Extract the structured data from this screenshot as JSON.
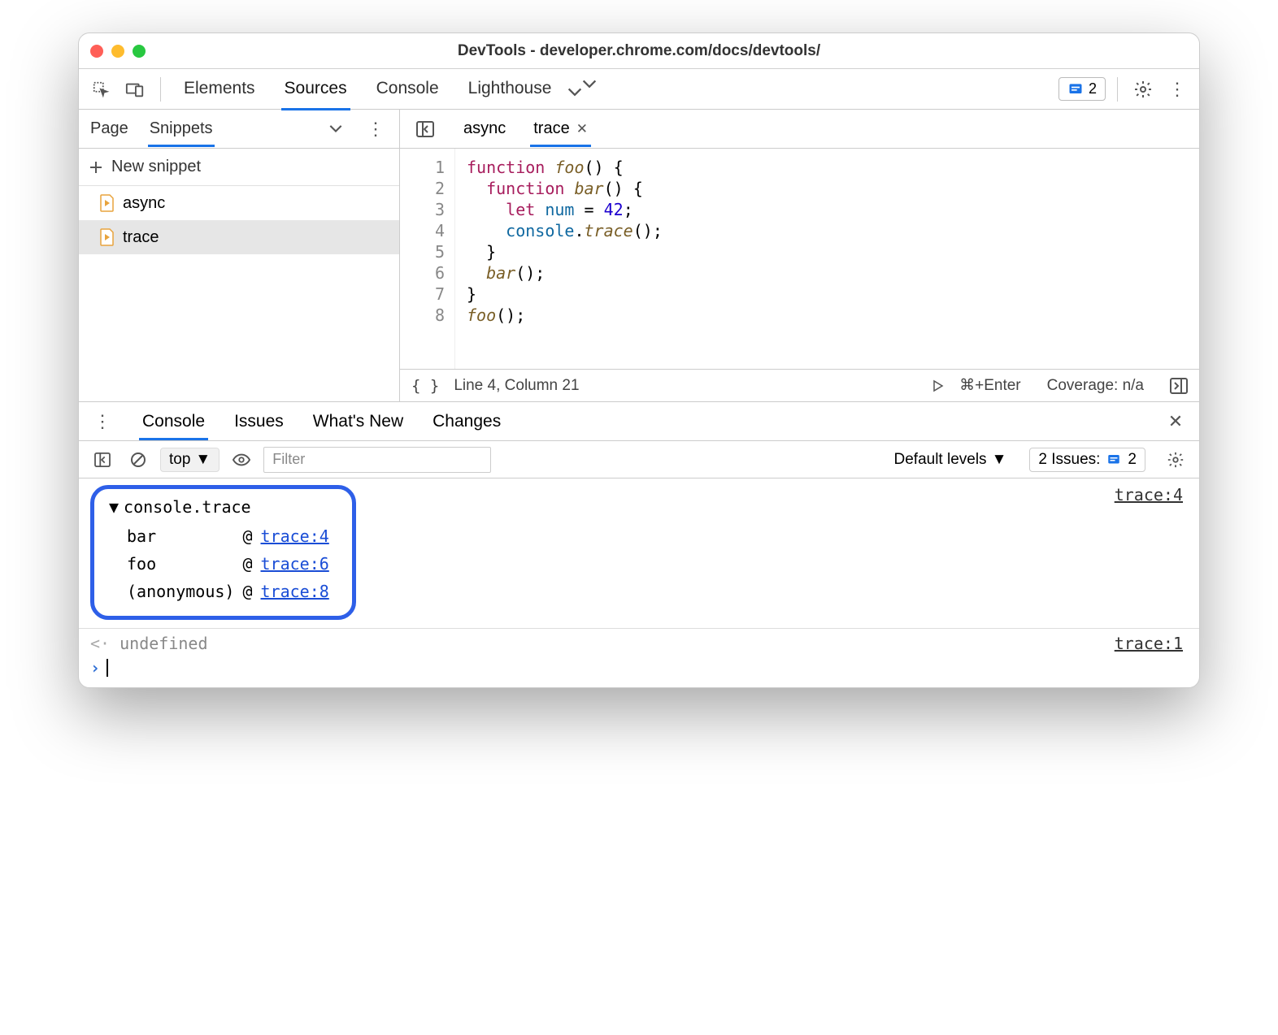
{
  "window": {
    "title": "DevTools - developer.chrome.com/docs/devtools/"
  },
  "toolbar": {
    "tabs": [
      "Elements",
      "Sources",
      "Console",
      "Lighthouse"
    ],
    "active": "Sources",
    "issues_count": "2"
  },
  "left": {
    "tabs": [
      "Page",
      "Snippets"
    ],
    "active": "Snippets",
    "new_label": "New snippet",
    "files": [
      "async",
      "trace"
    ],
    "selected": "trace"
  },
  "editor": {
    "tabs": [
      {
        "name": "async",
        "active": false,
        "closable": false
      },
      {
        "name": "trace",
        "active": true,
        "closable": true
      }
    ],
    "lines": [
      "1",
      "2",
      "3",
      "4",
      "5",
      "6",
      "7",
      "8"
    ],
    "code_plain": "function foo() {\n  function bar() {\n    let num = 42;\n    console.trace();\n  }\n  bar();\n}\nfoo();"
  },
  "statusbar": {
    "cursor": "Line 4, Column 21",
    "run_hint": "⌘+Enter",
    "coverage": "Coverage: n/a"
  },
  "drawer": {
    "tabs": [
      "Console",
      "Issues",
      "What's New",
      "Changes"
    ],
    "active": "Console"
  },
  "console_toolbar": {
    "context": "top",
    "filter_placeholder": "Filter",
    "levels": "Default levels",
    "issues_label": "2 Issues:",
    "issues_count": "2"
  },
  "console": {
    "trace_header": "console.trace",
    "trace_src_right": "trace:4",
    "stack": [
      {
        "fn": "bar",
        "loc": "trace:4"
      },
      {
        "fn": "foo",
        "loc": "trace:6"
      },
      {
        "fn": "(anonymous)",
        "loc": "trace:8"
      }
    ],
    "return_value": "undefined",
    "return_src": "trace:1"
  }
}
